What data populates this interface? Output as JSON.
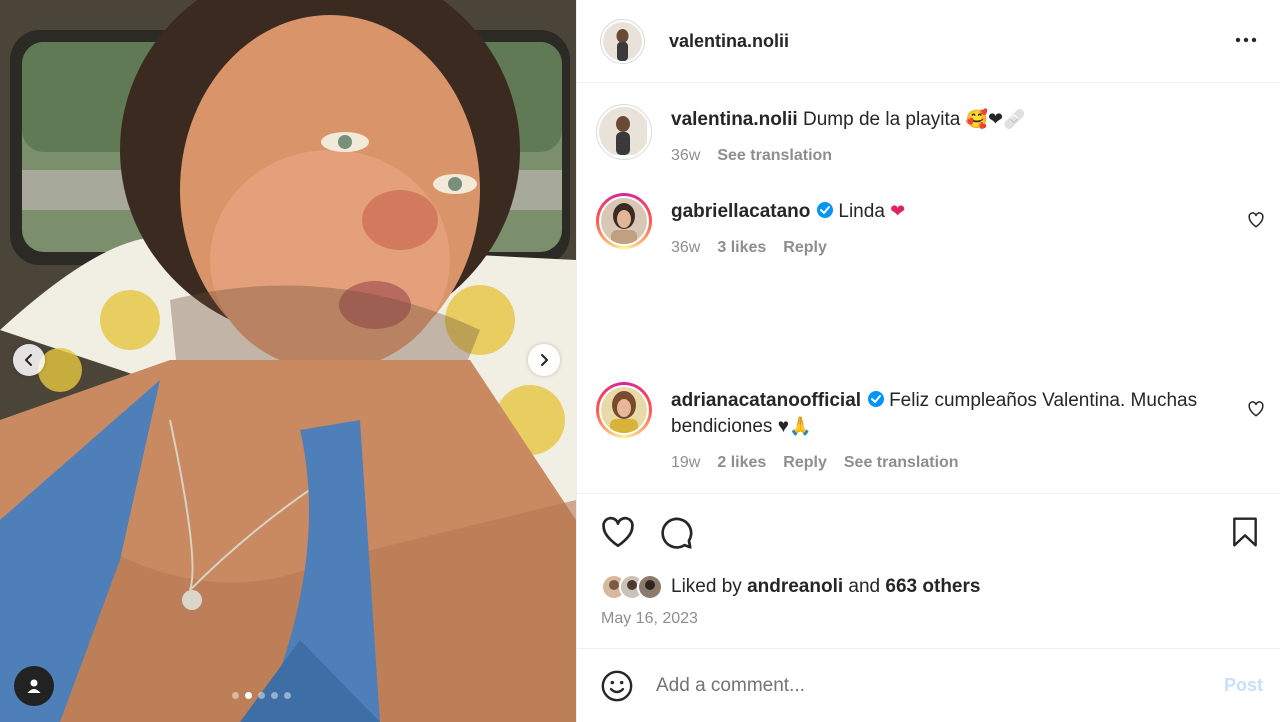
{
  "post": {
    "author": "valentina.nolii",
    "caption": {
      "username": "valentina.nolii",
      "text": "Dump de la playita",
      "emojis": "🥰❤🩹",
      "age": "36w",
      "see_translation": "See translation"
    },
    "comments": [
      {
        "username": "gabriellacatano",
        "verified": true,
        "text": "Linda",
        "emoji": "❤",
        "age": "36w",
        "likes": "3 likes",
        "reply": "Reply"
      },
      {
        "username": "adrianacatanoofficial",
        "verified": true,
        "text": "Feliz cumpleaños Valentina. Muchas bendiciones ♥",
        "emoji": "🙏",
        "age": "19w",
        "likes": "2 likes",
        "reply": "Reply",
        "see_translation": "See translation"
      }
    ],
    "liked_by": {
      "prefix": "Liked by",
      "user": "andreanoli",
      "conjunction": "and",
      "others": "663 others"
    },
    "date": "May 16, 2023",
    "add_comment_placeholder": "Add a comment...",
    "post_label": "Post",
    "carousel": {
      "total": 5,
      "active_index": 1
    }
  },
  "colors": {
    "accent": "#0095f6",
    "post_disabled": "#c7e0fd",
    "muted": "#8e8e8e",
    "text": "#262626"
  },
  "icons": [
    "more-icon",
    "heart-icon",
    "comment-icon",
    "bookmark-icon",
    "emoji-icon",
    "verified-icon",
    "chevron-left-icon",
    "chevron-right-icon",
    "user-tag-icon"
  ]
}
